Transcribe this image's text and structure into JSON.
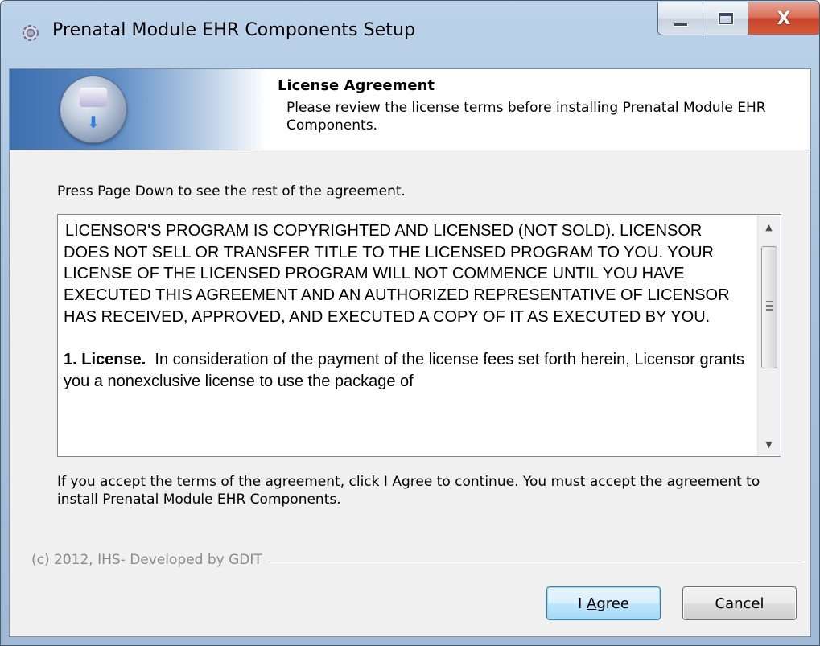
{
  "window": {
    "title": "Prenatal Module EHR Components Setup",
    "close_glyph": "X",
    "icons": {
      "app": "setup-gear-icon",
      "minimize": "minimize-icon",
      "maximize": "maximize-icon",
      "close": "close-icon"
    }
  },
  "header": {
    "title": "License Agreement",
    "subtitle": "Please review the license terms before installing Prenatal Module EHR Components.",
    "icon": "installer-disk-icon"
  },
  "hint": "Press Page Down to see the rest of the agreement.",
  "license": {
    "paragraph1": "LICENSOR'S PROGRAM IS COPYRIGHTED AND LICENSED (NOT SOLD). LICENSOR DOES NOT SELL OR TRANSFER TITLE TO THE LICENSED PROGRAM TO YOU. YOUR LICENSE OF THE LICENSED PROGRAM WILL NOT COMMENCE UNTIL YOU HAVE EXECUTED THIS AGREEMENT AND AN AUTHORIZED REPRESENTATIVE OF LICENSOR HAS RECEIVED, APPROVED, AND EXECUTED A COPY OF IT AS EXECUTED BY YOU.",
    "section1_heading": "1. License.",
    "section1_text": "In consideration of the payment of the license fees set forth herein, Licensor grants you a nonexclusive license to use the package of"
  },
  "accept_text": "If you accept the terms of the agreement, click I Agree to continue. You must accept the agreement to install Prenatal Module EHR Components.",
  "footer_text": "(c) 2012, IHS- Developed by GDIT",
  "buttons": {
    "agree_prefix": "I ",
    "agree_accel": "A",
    "agree_suffix": "gree",
    "cancel": "Cancel"
  }
}
